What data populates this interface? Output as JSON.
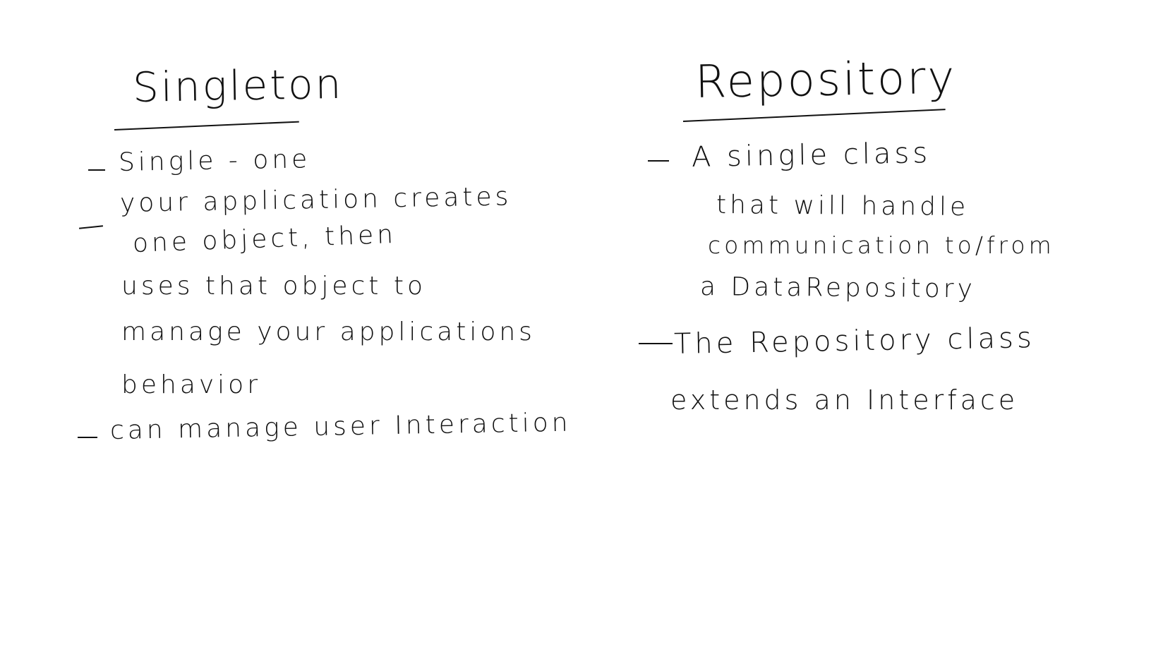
{
  "left_column": {
    "title": "Singleton",
    "items": [
      {
        "lines": [
          "Single - one"
        ]
      },
      {
        "lines": [
          "your application creates",
          "one object, then",
          "uses that object to",
          "manage your applications",
          "behavior"
        ]
      },
      {
        "lines": [
          "can manage user Interaction"
        ]
      }
    ]
  },
  "right_column": {
    "title": "Repository",
    "items": [
      {
        "lines": [
          "A single class",
          "that will handle",
          "communication to/from",
          "a DataRepository"
        ]
      },
      {
        "lines": [
          "The Repository class",
          "extends an Interface"
        ]
      }
    ]
  },
  "ink_color": "#111111",
  "background_color": "#ffffff"
}
